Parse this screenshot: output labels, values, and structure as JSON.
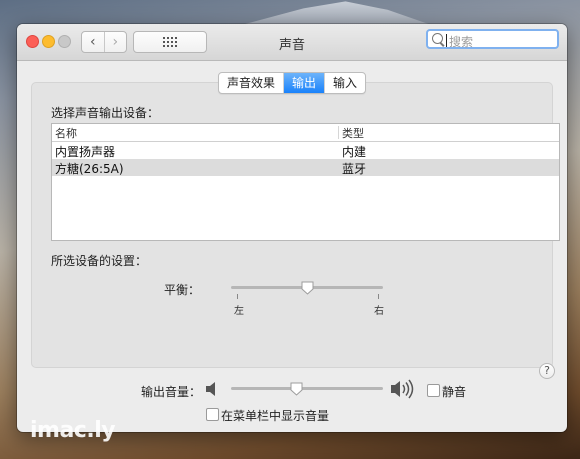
{
  "window": {
    "title": "声音"
  },
  "toolbar": {
    "search_placeholder": "搜索"
  },
  "tabs": [
    {
      "label": "声音效果",
      "active": false
    },
    {
      "label": "输出",
      "active": true
    },
    {
      "label": "输入",
      "active": false
    }
  ],
  "output": {
    "select_label": "选择声音输出设备：",
    "columns": [
      "名称",
      "类型"
    ],
    "devices": [
      {
        "name": "内置扬声器",
        "type": "内建",
        "selected": false
      },
      {
        "name": "方糖(26:5A)",
        "type": "蓝牙",
        "selected": true
      }
    ],
    "settings_label": "所选设备的设置：",
    "balance": {
      "label": "平衡：",
      "left": "左",
      "right": "右",
      "value": 0.5
    },
    "help": "?"
  },
  "volume": {
    "label": "输出音量：",
    "value": 0.43,
    "mute_label": "静音",
    "mute_checked": false,
    "menubar_label": "在菜单栏中显示音量",
    "menubar_checked": false
  },
  "watermark": "imac.ly",
  "colors": {
    "accent": "#1a82fb",
    "close": "#fc5f57",
    "minimize": "#fdbc2e",
    "zoom": "#c8c8c8"
  }
}
